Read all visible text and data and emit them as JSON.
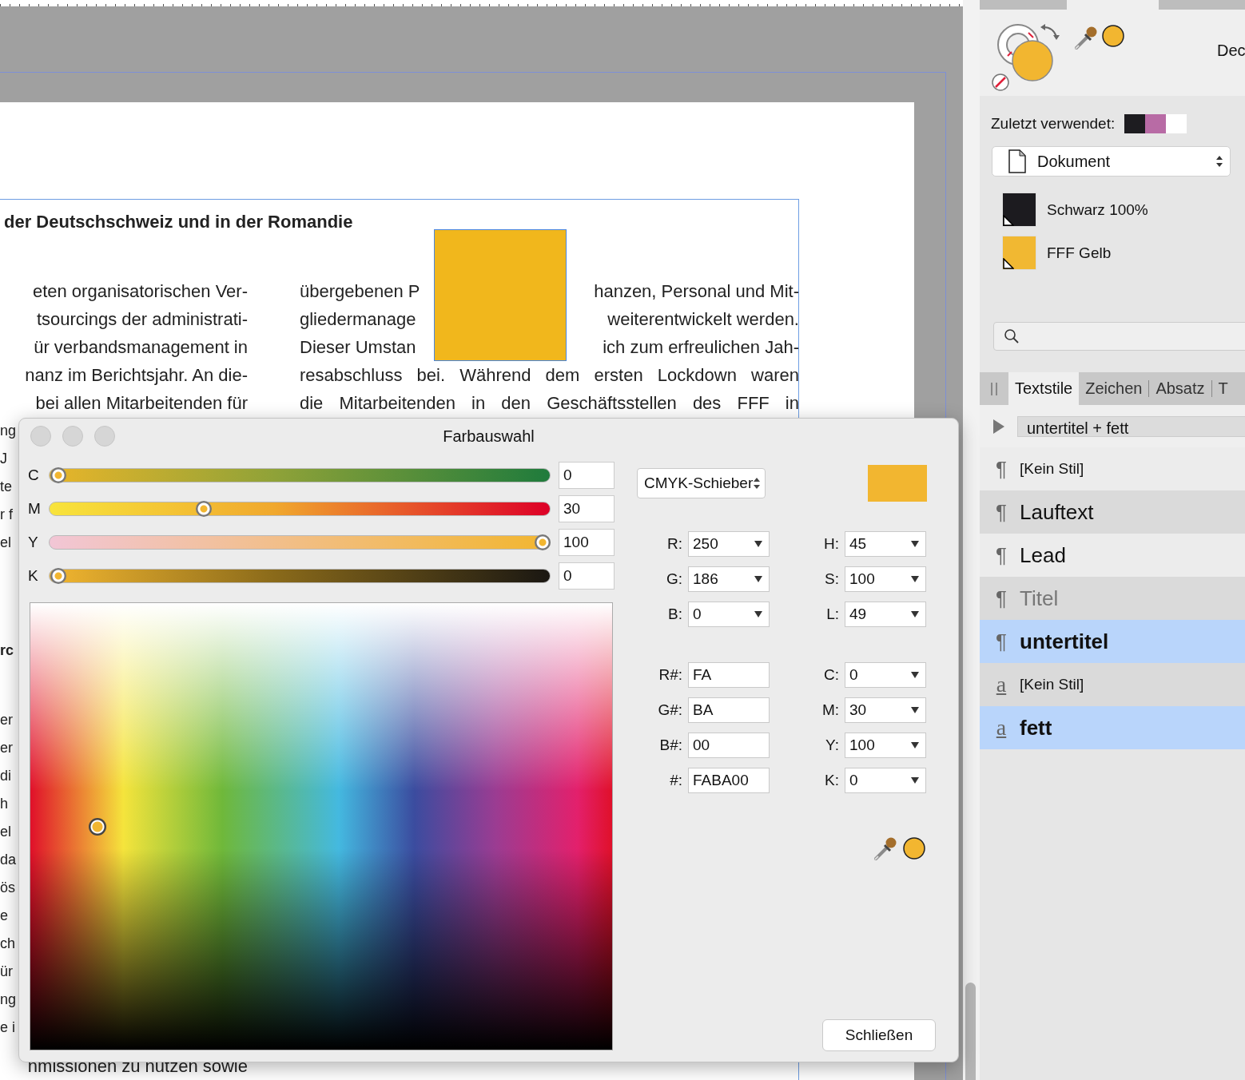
{
  "document": {
    "heading": "der Deutschschweiz und in der Romandie",
    "left_column": [
      {
        "kind": "full",
        "text": "eten organisatorischen Ver-"
      },
      {
        "kind": "full",
        "text": "tsourcings der administrati-"
      },
      {
        "kind": "full",
        "text": "ür verbandsmanagement in"
      },
      {
        "kind": "full",
        "text": "nanz im Berichtsjahr. An die-"
      },
      {
        "kind": "full",
        "text": "bei allen Mitarbeitenden für"
      },
      {
        "kind": "cut",
        "text": "ng"
      },
      {
        "kind": "cut",
        "text": "J"
      },
      {
        "kind": "cut",
        "text": "te"
      },
      {
        "kind": "cut",
        "text": "r f"
      },
      {
        "kind": "cut",
        "text": "el"
      },
      {
        "kind": "heading",
        "text": "rc"
      },
      {
        "kind": "cut",
        "text": "er"
      },
      {
        "kind": "cut",
        "text": "er"
      },
      {
        "kind": "cut",
        "text": "di"
      },
      {
        "kind": "cut",
        "text": "h"
      },
      {
        "kind": "cut",
        "text": "el"
      },
      {
        "kind": "cut",
        "text": "da"
      },
      {
        "kind": "cut",
        "text": "ös"
      },
      {
        "kind": "cut",
        "text": "e"
      },
      {
        "kind": "cut",
        "text": "ch"
      },
      {
        "kind": "cut",
        "text": "ür"
      },
      {
        "kind": "cut",
        "text": "ng"
      },
      {
        "kind": "cut",
        "text": "e i"
      },
      {
        "kind": "full",
        "text": "nmissionen zu nutzen sowie"
      }
    ],
    "right_column": [
      {
        "before": "übergebenen P",
        "after": "hanzen, Personal und Mit-"
      },
      {
        "before": "gliedermanage",
        "after": "weiterentwickelt werden."
      },
      {
        "before": "Dieser Umstan",
        "after": "ich zum erfreulichen Jah-"
      },
      {
        "text": "resabschluss bei. Während dem ersten Lockdown waren"
      },
      {
        "text": "die Mitarbeitenden in den Geschäftsstellen des FFF in"
      }
    ]
  },
  "color_dialog": {
    "title": "Farbauswahl",
    "sliders": [
      {
        "label": "C",
        "level": 0,
        "value": "0"
      },
      {
        "label": "M",
        "level": 0.3,
        "value": "30"
      },
      {
        "label": "Y",
        "level": 1,
        "value": "100"
      },
      {
        "label": "K",
        "level": 0,
        "value": "0"
      }
    ],
    "mode": "CMYK-Schieber",
    "fields": [
      {
        "label": "R:",
        "value": "250",
        "kind": "dropdown"
      },
      {
        "label": "H:",
        "value": "45",
        "kind": "dropdown"
      },
      {
        "label": "G:",
        "value": "186",
        "kind": "dropdown"
      },
      {
        "label": "S:",
        "value": "100",
        "kind": "dropdown"
      },
      {
        "label": "B:",
        "value": "0",
        "kind": "dropdown"
      },
      {
        "label": "L:",
        "value": "49",
        "kind": "dropdown"
      },
      {
        "label": "R#:",
        "value": "FA",
        "kind": "text"
      },
      {
        "label": "C:",
        "value": "0",
        "kind": "dropdown"
      },
      {
        "label": "G#:",
        "value": "BA",
        "kind": "text"
      },
      {
        "label": "M:",
        "value": "30",
        "kind": "dropdown"
      },
      {
        "label": "B#:",
        "value": "00",
        "kind": "text"
      },
      {
        "label": "Y:",
        "value": "100",
        "kind": "dropdown"
      },
      {
        "label": "#:",
        "value": "FABA00",
        "kind": "text"
      },
      {
        "label": "K:",
        "value": "0",
        "kind": "dropdown"
      }
    ],
    "close_button": "Schließen"
  },
  "side_panel": {
    "cut_label": "Dec",
    "recent_label": "Zuletzt verwendet:",
    "recent_swatches": [
      {
        "color": "#1d1c20"
      },
      {
        "color": "#b86ba5"
      },
      {
        "color": "#ffffff"
      }
    ],
    "palette": "Dokument",
    "swatches": [
      {
        "name": "Schwarz 100%",
        "color": "#1c1b1f"
      },
      {
        "name": "FFF Gelb",
        "color": "#f1b832"
      }
    ],
    "tabs": [
      {
        "label": "Textstile",
        "selected": true
      },
      {
        "label": "Zeichen",
        "selected": false
      },
      {
        "label": "Absatz",
        "selected": false
      },
      {
        "label": "T",
        "selected": false
      }
    ],
    "current_style": "untertitel + fett",
    "styles": [
      {
        "kind": "paragraph",
        "symbol": "¶",
        "name": "[Kein Stil]",
        "large": false,
        "bold": false,
        "muted": false,
        "selected": false
      },
      {
        "kind": "paragraph",
        "symbol": "¶",
        "name": "Lauftext",
        "large": true,
        "bold": false,
        "muted": false,
        "selected": false
      },
      {
        "kind": "paragraph",
        "symbol": "¶",
        "name": "Lead",
        "large": true,
        "bold": false,
        "muted": false,
        "selected": false
      },
      {
        "kind": "paragraph",
        "symbol": "¶",
        "name": "Titel",
        "large": true,
        "bold": false,
        "muted": true,
        "selected": false
      },
      {
        "kind": "paragraph",
        "symbol": "¶",
        "name": "untertitel",
        "large": true,
        "bold": true,
        "muted": false,
        "selected": true
      },
      {
        "kind": "character",
        "symbol": "a",
        "name": "[Kein Stil]",
        "large": false,
        "bold": false,
        "muted": false,
        "selected": false
      },
      {
        "kind": "character",
        "symbol": "a",
        "name": "fett",
        "large": true,
        "bold": true,
        "muted": false,
        "selected": true
      }
    ]
  }
}
